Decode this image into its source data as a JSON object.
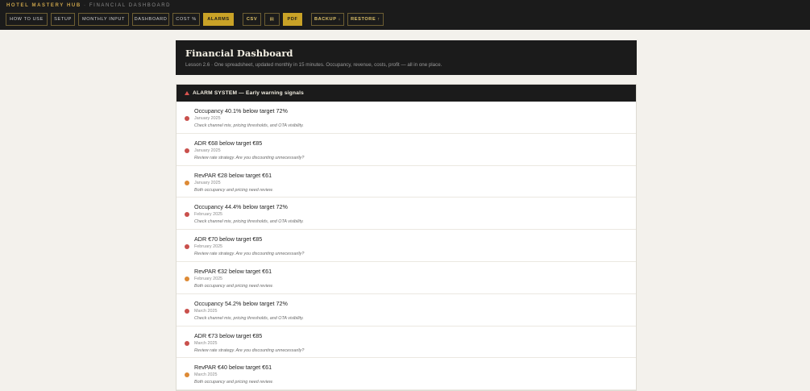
{
  "brand": {
    "name": "HOTEL MASTERY HUB",
    "section": "· FINANCIAL DASHBOARD"
  },
  "nav": [
    {
      "label": "HOW TO USE",
      "name": "nav-how-to-use",
      "width": 52,
      "style": ""
    },
    {
      "label": "SETUP",
      "name": "nav-setup",
      "width": 30,
      "style": ""
    },
    {
      "label": "MONTHLY INPUT",
      "name": "nav-monthly-input",
      "width": 63,
      "style": ""
    },
    {
      "label": "DASHBOARD",
      "name": "nav-dashboard",
      "width": 46,
      "style": ""
    },
    {
      "label": "COST %",
      "name": "nav-cost-percent",
      "width": 34,
      "style": ""
    },
    {
      "label": "ALARMS",
      "name": "nav-alarms",
      "width": 38,
      "style": "active"
    },
    {
      "sep": true
    },
    {
      "label": "CSV",
      "name": "nav-csv-button",
      "width": 23,
      "style": "gold"
    },
    {
      "label": "▤",
      "name": "nav-calendar-button",
      "width": 19,
      "style": "gold"
    },
    {
      "label": "PDF",
      "name": "nav-pdf-button",
      "width": 24,
      "style": "active"
    },
    {
      "sep": true
    },
    {
      "label": "BACKUP ↓",
      "name": "nav-backup-button",
      "width": 41,
      "style": "gold"
    },
    {
      "label": "RESTORE ↑",
      "name": "nav-restore-button",
      "width": 45,
      "style": "gold"
    }
  ],
  "hero": {
    "title": "Financial Dashboard",
    "subtitle": "Lesson 2.6 · One spreadsheet, updated monthly in 15 minutes. Occupancy, revenue, costs, profit — all in one place."
  },
  "alarm_panel": {
    "title": "ALARM SYSTEM — Early warning signals",
    "severity_colors": {
      "high": "#c9504c",
      "medium": "#dd8a35"
    },
    "alarms": [
      {
        "title": "Occupancy 40.1% below target 72%",
        "month": "January 2025",
        "hint": "Check channel mix, pricing thresholds, and OTA visibility.",
        "severity": "high"
      },
      {
        "title": "ADR €68 below target €85",
        "month": "January 2025",
        "hint": "Review rate strategy. Are you discounting unnecessarily?",
        "severity": "high"
      },
      {
        "title": "RevPAR €28 below target €61",
        "month": "January 2025",
        "hint": "Both occupancy and pricing need review.",
        "severity": "medium"
      },
      {
        "title": "Occupancy 44.4% below target 72%",
        "month": "February 2025",
        "hint": "Check channel mix, pricing thresholds, and OTA visibility.",
        "severity": "high"
      },
      {
        "title": "ADR €70 below target €85",
        "month": "February 2025",
        "hint": "Review rate strategy. Are you discounting unnecessarily?",
        "severity": "high"
      },
      {
        "title": "RevPAR €32 below target €61",
        "month": "February 2025",
        "hint": "Both occupancy and pricing need review.",
        "severity": "medium"
      },
      {
        "title": "Occupancy 54.2% below target 72%",
        "month": "March 2025",
        "hint": "Check channel mix, pricing thresholds, and OTA visibility.",
        "severity": "high"
      },
      {
        "title": "ADR €73 below target €85",
        "month": "March 2025",
        "hint": "Review rate strategy. Are you discounting unnecessarily?",
        "severity": "high"
      },
      {
        "title": "RevPAR €40 below target €61",
        "month": "March 2025",
        "hint": "Both occupancy and pricing need review.",
        "severity": "medium"
      }
    ]
  }
}
